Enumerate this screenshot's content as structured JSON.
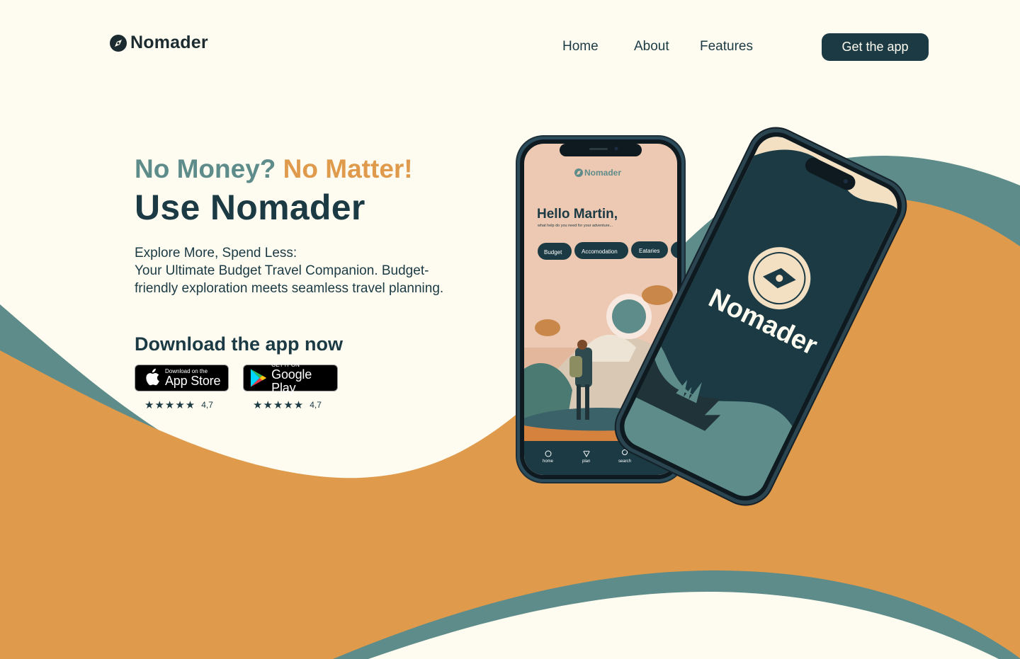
{
  "brand": {
    "name": "Nomader"
  },
  "nav": {
    "links": [
      "Home",
      "About",
      "Features"
    ],
    "cta": "Get the app"
  },
  "hero": {
    "tagline_a": "No Money?",
    "tagline_b": "No Matter!",
    "headline": "Use Nomader",
    "desc_line1": "Explore More, Spend Less:",
    "desc_line2": "Your Ultimate Budget Travel Companion. Budget-friendly exploration meets seamless travel planning."
  },
  "download": {
    "title": "Download the app now",
    "appstore": {
      "small": "Download on the",
      "big": "App Store",
      "rating": "4,7"
    },
    "googleplay": {
      "small": "GET IT ON",
      "big": "Google Play",
      "rating": "4,7"
    },
    "stars": "★★★★★"
  },
  "phone_screen": {
    "app_name": "Nomader",
    "greeting": "Hello Martin,",
    "subtitle": "what help do you need for your adventure...",
    "chips": [
      "Budget",
      "Accomodation",
      "Eataries"
    ],
    "nav": [
      "home",
      "plan",
      "search"
    ]
  },
  "splash": {
    "app_name": "Nomader"
  },
  "colors": {
    "background": "#FEFCF0",
    "dark_teal": "#1B3A44",
    "teal": "#5E8C8A",
    "orange": "#DF9A4C"
  }
}
